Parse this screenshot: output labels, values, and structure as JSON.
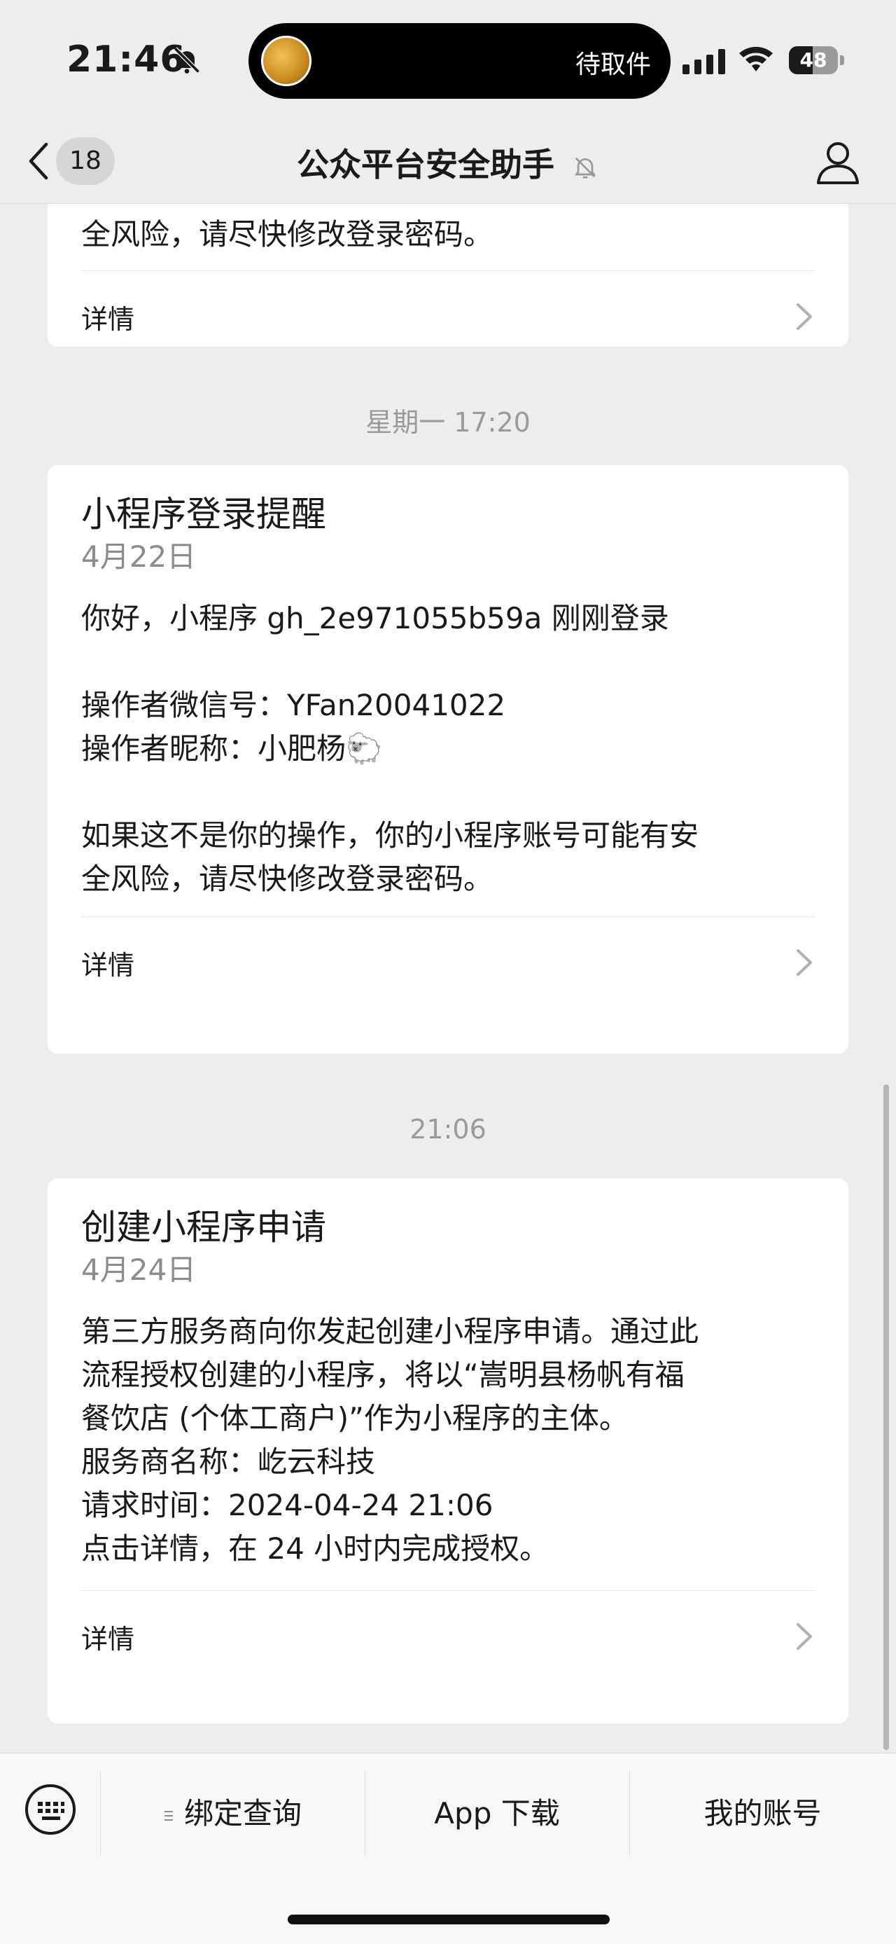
{
  "status_bar": {
    "time": "21:46",
    "island_text": "待取件",
    "battery": "48",
    "battery_fraction": 0.48
  },
  "nav": {
    "back_badge": "18",
    "title": "公众平台安全助手"
  },
  "cards": [
    {
      "partial_text": "全风险，请尽快修改登录密码。",
      "detail_label": "详情"
    },
    {
      "timestamp": "星期一 17:20",
      "title": "小程序登录提醒",
      "date": "4月22日",
      "lines": [
        "你好，小程序 gh_2e971055b59a 刚刚登录",
        "",
        "操作者微信号：YFan20041022",
        "操作者昵称：小肥杨🐑",
        "",
        "如果这不是你的操作，你的小程序账号可能有安",
        "全风险，请尽快修改登录密码。"
      ],
      "detail_label": "详情"
    },
    {
      "timestamp": "21:06",
      "title": "创建小程序申请",
      "date": "4月24日",
      "lines": [
        "第三方服务商向你发起创建小程序申请。通过此",
        "流程授权创建的小程序，将以“嵩明县杨帆有福",
        "餐饮店 (个体工商户)”作为小程序的主体。",
        "服务商名称：屹云科技",
        "请求时间：2024-04-24 21:06",
        "点击详情，在 24 小时内完成授权。"
      ],
      "detail_label": "详情"
    }
  ],
  "menu": {
    "items": [
      "绑定查询",
      "App 下载",
      "我的账号"
    ]
  },
  "colors": {
    "background": "#ededed",
    "card": "#ffffff",
    "muted_text": "#8c8c8c"
  }
}
